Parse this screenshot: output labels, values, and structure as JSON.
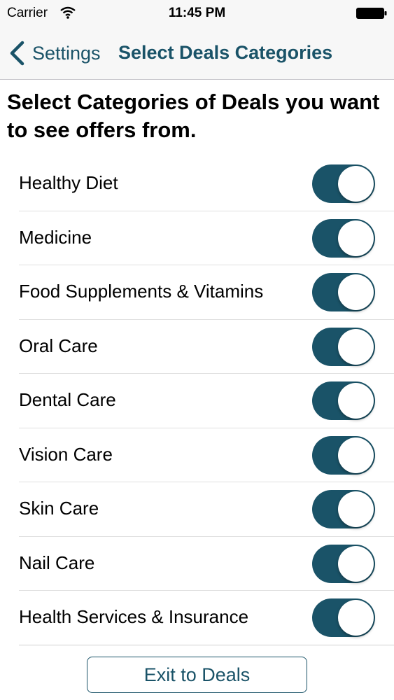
{
  "status_bar": {
    "carrier": "Carrier",
    "time": "11:45 PM",
    "icons": [
      "wifi-icon",
      "battery-icon"
    ]
  },
  "nav": {
    "back_label": "Settings",
    "back_icon": "chevron-left-icon",
    "title": "Select Deals Categories"
  },
  "intro": "Select Categories of Deals you want to see offers from.",
  "categories": [
    {
      "label": "Healthy Diet",
      "enabled": true
    },
    {
      "label": "Medicine",
      "enabled": true
    },
    {
      "label": "Food Supplements & Vitamins",
      "enabled": true
    },
    {
      "label": "Oral Care",
      "enabled": true
    },
    {
      "label": "Dental Care",
      "enabled": true
    },
    {
      "label": "Vision Care",
      "enabled": true
    },
    {
      "label": "Skin Care",
      "enabled": true
    },
    {
      "label": "Nail Care",
      "enabled": true
    },
    {
      "label": "Health Services & Insurance",
      "enabled": true
    }
  ],
  "exit_button": "Exit to Deals",
  "colors": {
    "accent": "#1a5368",
    "bar_background": "#f7f7f7",
    "separator": "#e0e0e0"
  }
}
